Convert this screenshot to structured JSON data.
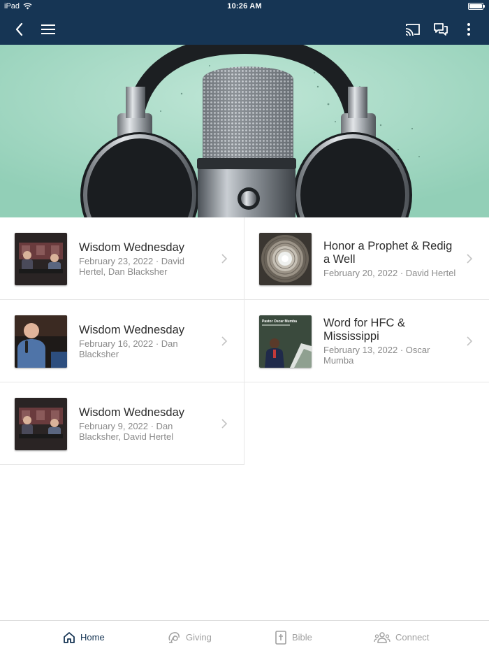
{
  "status_bar": {
    "device": "iPad",
    "time": "10:26 AM"
  },
  "nav": {
    "icons": [
      "back-icon",
      "menu-icon",
      "cast-icon",
      "chat-icon",
      "more-icon"
    ]
  },
  "colors": {
    "brand": "#163554",
    "hero_bg": "#a6dac6"
  },
  "items": [
    {
      "title": "Wisdom Wednesday",
      "meta": "February 23, 2022 · David Hertel, Dan Blacksher",
      "thumb": "studio"
    },
    {
      "title": "Honor a Prophet & Redig a Well",
      "meta": "February 20, 2022 · David Hertel",
      "thumb": "well"
    },
    {
      "title": "Wisdom Wednesday",
      "meta": "February 16, 2022 · Dan Blacksher",
      "thumb": "portrait"
    },
    {
      "title": "Word for HFC & Mississippi",
      "meta": "February 13, 2022 · Oscar Mumba",
      "thumb": "pastor",
      "thumb_text": "Pastor Oscar Mumba"
    },
    {
      "title": "Wisdom Wednesday",
      "meta": "February 9, 2022 · Dan Blacksher, David Hertel",
      "thumb": "studio"
    }
  ],
  "tabs": [
    {
      "label": "Home",
      "icon": "home-icon",
      "active": true
    },
    {
      "label": "Giving",
      "icon": "giving-icon",
      "active": false
    },
    {
      "label": "Bible",
      "icon": "bible-icon",
      "active": false
    },
    {
      "label": "Connect",
      "icon": "connect-icon",
      "active": false
    }
  ]
}
